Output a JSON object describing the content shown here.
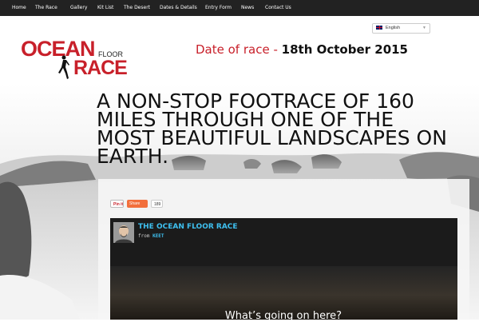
{
  "nav": {
    "items": [
      "Home",
      "The Race",
      "Gallery",
      "Kit List",
      "The Desert",
      "Dates & Details",
      "Entry Form",
      "News",
      "Contact Us"
    ]
  },
  "language": {
    "selected": "English",
    "icon": "uk-flag-icon"
  },
  "logo": {
    "line1": "OCEAN",
    "line2": "FLOOR",
    "line3": "RACE",
    "icon": "runner-icon"
  },
  "race_date": {
    "label": "Date of race -",
    "value": "18th October 2015"
  },
  "hero": {
    "tagline": "A NON-STOP FOOTRACE OF 160 MILES THROUGH ONE OF THE MOST BEAUTIFUL LANDSCAPES ON EARTH."
  },
  "share": {
    "pin_label": "Pin it",
    "share_label": "Share",
    "count": "189"
  },
  "video": {
    "title": "THE OCEAN FLOOR RACE",
    "from_label": "from",
    "author": "KEET",
    "caption": "What’s going on here?"
  },
  "colors": {
    "brand_red": "#c8202a",
    "nav_bg": "#222222",
    "link_blue": "#3ec0f0",
    "share_orange": "#f26f3c"
  }
}
